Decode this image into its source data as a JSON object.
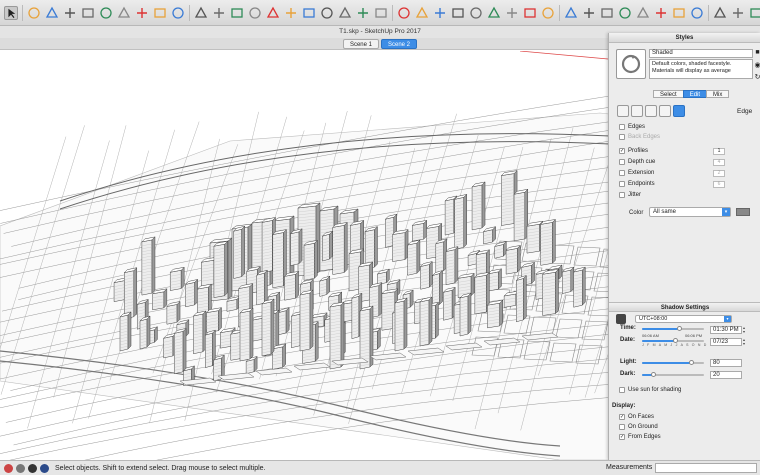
{
  "window": {
    "title": "T1.skp - SketchUp Pro 2017"
  },
  "scenes": [
    {
      "label": "Scene 1",
      "active": false
    },
    {
      "label": "Scene 2",
      "active": true
    }
  ],
  "toolbar": {
    "icons": [
      "select-icon",
      "component-icon",
      "paint-icon",
      "eraser-icon",
      "line-icon",
      "arc-icon",
      "rectangle-icon",
      "circle-icon",
      "polygon-icon",
      "move-icon",
      "rotate-icon",
      "scale-icon",
      "push-pull-icon",
      "follow-me-icon",
      "offset-icon",
      "tape-measure-icon",
      "dimension-icon",
      "protractor-icon",
      "text-icon",
      "axes-icon",
      "3d-text-icon",
      "orbit-icon",
      "pan-icon",
      "zoom-icon",
      "zoom-window-icon",
      "zoom-extents-icon",
      "previous-view-icon",
      "position-camera-icon",
      "walk-icon",
      "look-around-icon",
      "section-plane-icon",
      "x-ray-icon",
      "back-edges-icon",
      "wireframe-icon",
      "hidden-line-icon",
      "shaded-icon",
      "shaded-textures-icon",
      "monochrome-icon",
      "iso-view-icon",
      "top-view-icon",
      "front-view-icon",
      "right-view-icon",
      "back-view-icon",
      "left-view-icon",
      "sandbox-icon",
      "warehouse-icon",
      "extension-icon",
      "share-icon",
      "layout-icon",
      "sun-icon"
    ]
  },
  "styles": {
    "panel_title": "Styles",
    "name": "Shaded",
    "description": "Default colors, shaded facestyle. Materials will display as average",
    "tabs": [
      {
        "label": "Select",
        "active": false
      },
      {
        "label": "Edit",
        "active": true
      },
      {
        "label": "Mix",
        "active": false
      }
    ],
    "category_label": "Edge",
    "edge_options": [
      {
        "label": "Edges",
        "checked": false,
        "disabled": false,
        "value": ""
      },
      {
        "label": "Back Edges",
        "checked": false,
        "disabled": true,
        "value": ""
      },
      {
        "label": "Profiles",
        "checked": true,
        "disabled": false,
        "value": "1"
      },
      {
        "label": "Depth cue",
        "checked": false,
        "disabled": false,
        "value": "4"
      },
      {
        "label": "Extension",
        "checked": false,
        "disabled": false,
        "value": "2"
      },
      {
        "label": "Endpoints",
        "checked": false,
        "disabled": false,
        "value": "6"
      },
      {
        "label": "Jitter",
        "checked": false,
        "disabled": false,
        "value": ""
      }
    ],
    "color_label": "Color",
    "color_value": "All same",
    "swatch_color": "#888888"
  },
  "shadow": {
    "panel_title": "Shadow Settings",
    "timezone": "UTC+08:00",
    "time_label": "Time:",
    "time_start": "06:06 AM",
    "time_end": "06:06 PM",
    "time_value": "01:30 PM",
    "time_fraction": 0.62,
    "date_label": "Date:",
    "months": "J F M A M J J A S O N D",
    "date_value": "07/23",
    "date_fraction": 0.55,
    "light_label": "Light:",
    "light_value": "80",
    "dark_label": "Dark:",
    "dark_value": "20",
    "use_sun_label": "Use sun for shading",
    "use_sun": false,
    "display_label": "Display:",
    "on_faces_label": "On Faces",
    "on_faces": true,
    "on_ground_label": "On Ground",
    "on_ground": false,
    "from_edges_label": "From Edges",
    "from_edges": true
  },
  "status": {
    "message": "Select objects. Shift to extend select. Drag mouse to select multiple.",
    "measurements_label": "Measurements"
  },
  "colors": {
    "accent": "#3d8de6",
    "panel_bg": "#ececec",
    "toolbar_bg": "#dcdcdc"
  }
}
